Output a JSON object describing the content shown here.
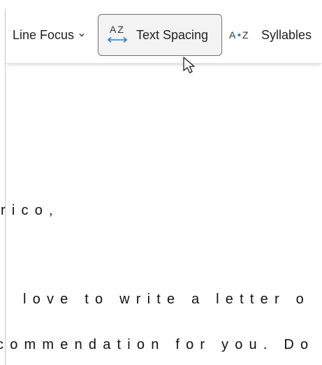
{
  "toolbar": {
    "line_focus_label": "Line Focus",
    "text_spacing_label": "Text Spacing",
    "text_spacing_icon_text": "AZ",
    "syllables_label": "Syllables",
    "syllables_icon_text": "A·Z",
    "accent_color": "#2b7cd3"
  },
  "document": {
    "lines": [
      "rico,",
      "love to write a letter o",
      "commendation for you. Do"
    ]
  }
}
